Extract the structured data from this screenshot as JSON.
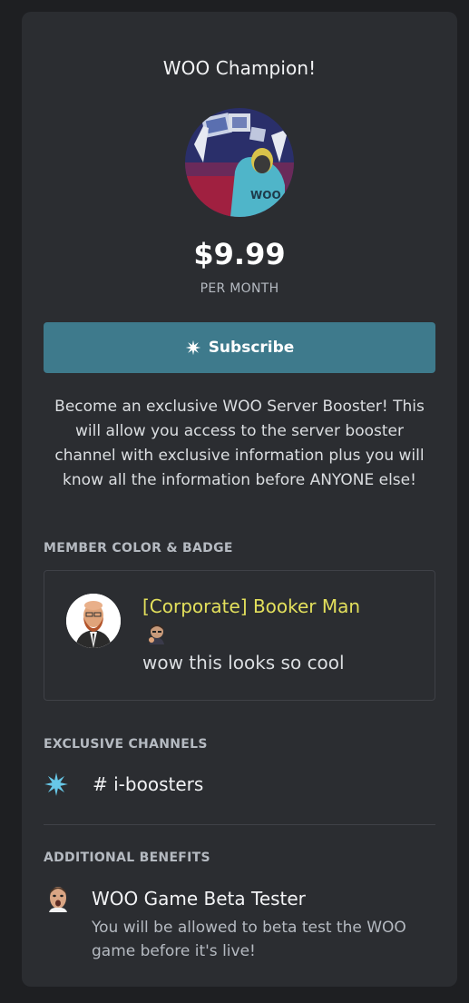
{
  "tier": {
    "title": "WOO Champion!",
    "price": "$9.99",
    "period": "PER MONTH",
    "subscribe_label": "Subscribe",
    "description": "Become an exclusive WOO Server Booster! This will allow you access to the server booster channel with exclusive information plus you will know all the information before ANYONE else!"
  },
  "member_color": {
    "heading": "MEMBER COLOR & BADGE",
    "preview_name": "[Corporate] Booker Man",
    "preview_message": "wow this looks so cool",
    "name_color": "#e3e05c"
  },
  "channels": {
    "heading": "EXCLUSIVE CHANNELS",
    "items": [
      {
        "icon": "boost-sparkle-icon",
        "hash": "#",
        "name": "i-boosters"
      }
    ]
  },
  "benefits": {
    "heading": "ADDITIONAL BENEFITS",
    "items": [
      {
        "icon": "face-emoji-icon",
        "title": "WOO Game Beta Tester",
        "description": "You will be allowed to beta test the WOO game before it's live!"
      }
    ]
  },
  "colors": {
    "background": "#1e1f22",
    "card": "#2b2d31",
    "accent_button": "#3e7a8c",
    "boost_icon": "#67c8e8"
  }
}
